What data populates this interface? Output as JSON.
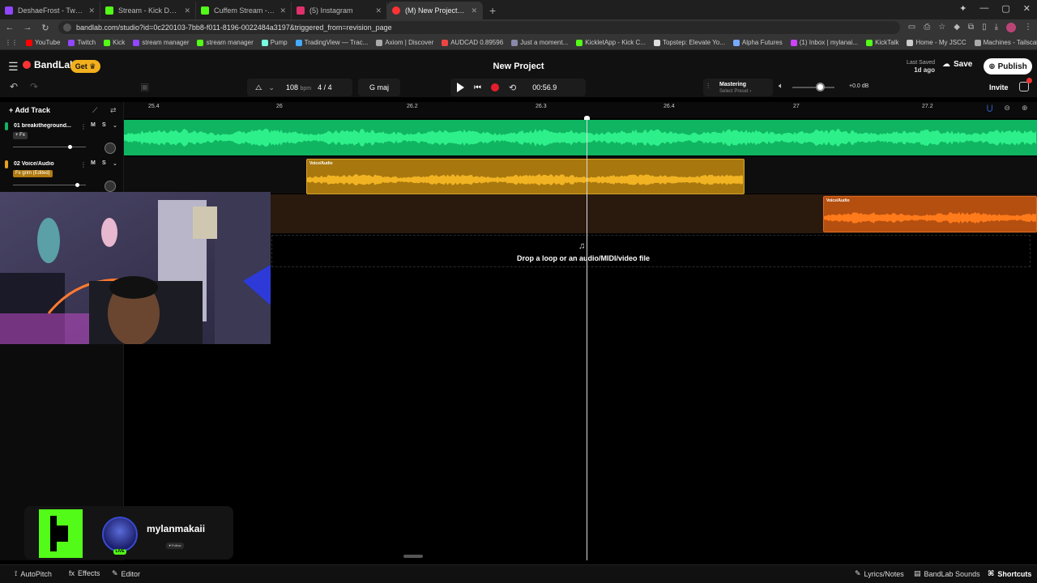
{
  "browser": {
    "tabs": [
      {
        "label": "DeshaeFrost - Twitch",
        "color": "#9146ff"
      },
      {
        "label": "Stream - Kick Dashboard",
        "color": "#53fc18"
      },
      {
        "label": "Cuffem Stream - Watch Live on",
        "color": "#53fc18"
      },
      {
        "label": "(5) Instagram",
        "color": "#e1306c"
      },
      {
        "label": "(M) New Project - Studio",
        "color": "#f33"
      }
    ],
    "url": "bandlab.com/studio?id=0c220103-7bb8-f011-8196-0022484a3197&triggered_from=revision_page",
    "bookmarks": [
      "YouTube",
      "Twitch",
      "Kick",
      "stream manager",
      "stream manager",
      "Pump",
      "TradingView — Trac...",
      "Axiom | Discover",
      "AUDCAD 0.89596",
      "Just a moment...",
      "KickletApp - Kick C...",
      "Topstep: Elevate Yo...",
      "Alpha Futures",
      "(1) Inbox | mylanai...",
      "KickTalk",
      "Home - My JSCC",
      "Machines - Tailscale"
    ]
  },
  "app": {
    "logo": "BandLab",
    "get_label": "Get",
    "project_title": "New Project",
    "last_saved_label": "Last Saved",
    "last_saved_value": "1d ago",
    "save_label": "Save",
    "publish_label": "Publish",
    "invite_label": "Invite",
    "notification_count": "3"
  },
  "transport": {
    "bpm": "108",
    "bpm_unit": "bpm",
    "time_sig": "4 / 4",
    "key": "G maj",
    "timecode": "00:56.9",
    "mastering_title": "Mastering",
    "mastering_sub": "Select Preset",
    "db": "+0.0 dB"
  },
  "tracks": {
    "add_label": "Add Track",
    "list": [
      {
        "number": "01",
        "name": "breakitheground...",
        "fx": "+ Fx",
        "color": "#10b561",
        "fx_color": "#333",
        "mute": "M",
        "solo": "S",
        "volume": 0.78
      },
      {
        "number": "02",
        "name": "Voice/Audio",
        "fx": "Fx grim (Edited)",
        "color": "#e6a21c",
        "fx_color": "#b07a10",
        "mute": "M",
        "solo": "S",
        "volume": 0.87
      }
    ]
  },
  "ruler": {
    "marks": [
      "25.4",
      "26",
      "26.2",
      "26.3",
      "26.4",
      "27",
      "27.2"
    ]
  },
  "clips": {
    "clip1_label": "Voice/Audio",
    "clip2_label": "Voice/Audio"
  },
  "dropzone": {
    "text": "Drop a loop or an audio/MIDI/video file"
  },
  "stream": {
    "username": "mylanmakaii",
    "live_label": "LIVE",
    "follow_label": "♥ Follow"
  },
  "bottombar": {
    "autopitch": "AutoPitch",
    "effects": "Effects",
    "editor": "Editor",
    "lyrics": "Lyrics/Notes",
    "sounds": "BandLab Sounds",
    "shortcuts": "Shortcuts"
  }
}
